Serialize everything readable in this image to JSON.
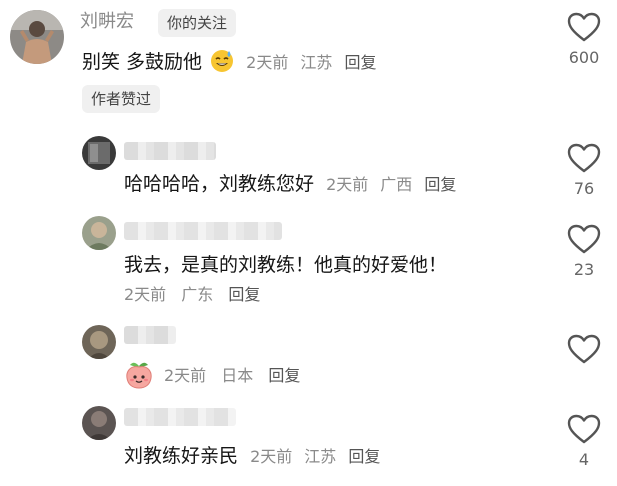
{
  "main_comment": {
    "author": "刘畊宏",
    "follow_tag": "你的关注",
    "text": "别笑 多鼓励他",
    "emoji": "sweat-smile-emoji",
    "time": "2天前",
    "location": "江苏",
    "reply_label": "回复",
    "like_count": "600",
    "author_liked_badge": "作者赞过"
  },
  "replies": [
    {
      "text": "哈哈哈哈，刘教练您好",
      "time": "2天前",
      "location": "广西",
      "reply_label": "回复",
      "like_count": "76"
    },
    {
      "text": "我去，是真的刘教练！他真的好爱他！",
      "time": "2天前",
      "location": "广东",
      "reply_label": "回复",
      "like_count": "23"
    },
    {
      "sticker": "peach-sticker",
      "time": "2天前",
      "location": "日本",
      "reply_label": "回复",
      "like_count": ""
    },
    {
      "text": "刘教练好亲民",
      "time": "2天前",
      "location": "江苏",
      "reply_label": "回复",
      "like_count": "4"
    }
  ],
  "colors": {
    "text": "#161616",
    "meta": "#8a8a8a",
    "tag_bg": "#f0f0f0",
    "heart_stroke": "#555555"
  }
}
